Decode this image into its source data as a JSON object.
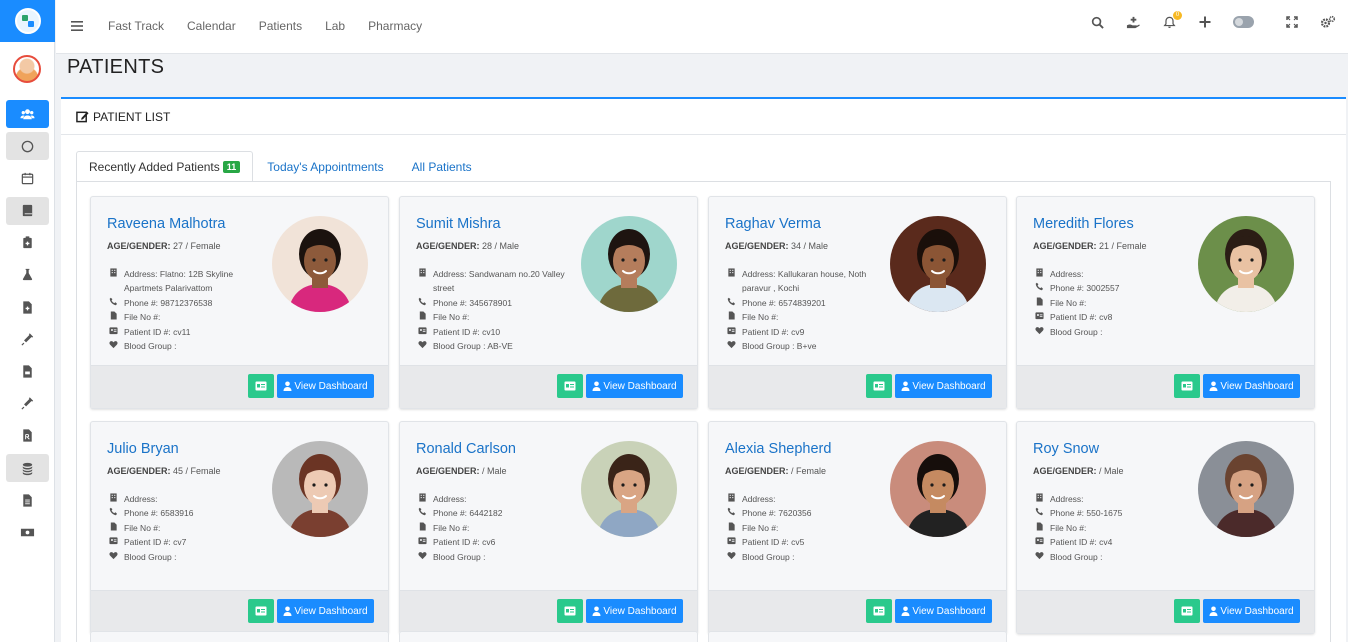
{
  "nav": {
    "items": [
      "Fast Track",
      "Calendar",
      "Patients",
      "Lab",
      "Pharmacy"
    ]
  },
  "notifications": {
    "count": "0"
  },
  "page": {
    "title": "PATIENTS"
  },
  "panel": {
    "title": "PATIENT LIST"
  },
  "tabs": [
    {
      "label": "Recently Added Patients",
      "badge": "11"
    },
    {
      "label": "Today's Appointments"
    },
    {
      "label": "All Patients"
    }
  ],
  "labels": {
    "age_gender": "AGE/GENDER:",
    "view_dashboard": "View Dashboard"
  },
  "patients": [
    {
      "name": "Raveena Malhotra",
      "age_gender": " 27 / Female",
      "address": "Address: Flatno: 12B Skyline Apartmets Palarivattom",
      "phone": "Phone #: 98712376538",
      "file": "File No #:",
      "patient_id": "Patient ID #: cv11",
      "blood": "Blood Group :",
      "photo": {
        "bg": "#f1e3d8",
        "skin": "#8d5a3b",
        "hair": "#1b120e",
        "shirt": "#d8287d"
      }
    },
    {
      "name": "Sumit Mishra",
      "age_gender": " 28 / Male",
      "address": "Address: Sandwanam no.20 Valley street",
      "phone": "Phone #: 345678901",
      "file": "File No #:",
      "patient_id": "Patient ID #: cv10",
      "blood": "Blood Group : AB-VE",
      "photo": {
        "bg": "#9fd6cc",
        "skin": "#b57d5c",
        "hair": "#1e1410",
        "shirt": "#6e6a3c"
      }
    },
    {
      "name": "Raghav Verma",
      "age_gender": " 34 / Male",
      "address": "Address: Kallukaran house, Noth paravur , Kochi",
      "phone": "Phone #: 6574839201",
      "file": "File No #:",
      "patient_id": "Patient ID #: cv9",
      "blood": "Blood Group : B+ve",
      "photo": {
        "bg": "#5a2a1c",
        "skin": "#8b5535",
        "hair": "#1a0f0a",
        "shirt": "#dbe7f2"
      }
    },
    {
      "name": "Meredith Flores",
      "age_gender": " 21 / Female",
      "address": "Address:",
      "phone": "Phone #: 3002557",
      "file": "File No #:",
      "patient_id": "Patient ID #: cv8",
      "blood": "Blood Group :",
      "photo": {
        "bg": "#6c8f4a",
        "skin": "#e9c2a3",
        "hair": "#2b1d15",
        "shirt": "#f2eee8"
      }
    },
    {
      "name": "Julio Bryan",
      "age_gender": " 45 / Female",
      "address": "Address:",
      "phone": "Phone #: 6583916",
      "file": "File No #:",
      "patient_id": "Patient ID #: cv7",
      "blood": "Blood Group :",
      "photo": {
        "bg": "#b9b9b9",
        "skin": "#edcab4",
        "hair": "#6b3424",
        "shirt": "#7a3f30"
      }
    },
    {
      "name": "Ronald Carlson",
      "age_gender": " / Male",
      "address": "Address:",
      "phone": "Phone #: 6442182",
      "file": "File No #:",
      "patient_id": "Patient ID #: cv6",
      "blood": "Blood Group :",
      "photo": {
        "bg": "#c9d2b8",
        "skin": "#d9a584",
        "hair": "#3a2418",
        "shirt": "#8fa7c4"
      }
    },
    {
      "name": "Alexia Shepherd",
      "age_gender": " / Female",
      "address": "Address:",
      "phone": "Phone #: 7620356",
      "file": "File No #:",
      "patient_id": "Patient ID #: cv5",
      "blood": "Blood Group :",
      "photo": {
        "bg": "#c98c7c",
        "skin": "#c58a61",
        "hair": "#160e0b",
        "shirt": "#222222"
      }
    },
    {
      "name": "Roy Snow",
      "age_gender": " / Male",
      "address": "Address:",
      "phone": "Phone #: 550-1675",
      "file": "File No #:",
      "patient_id": "Patient ID #: cv4",
      "blood": "Blood Group :",
      "photo": {
        "bg": "#8a8f97",
        "skin": "#d6a283",
        "hair": "#6a4330",
        "shirt": "#4b2a2a"
      }
    }
  ],
  "colors": {
    "primary": "#1a8cff",
    "success": "#28a745",
    "teal": "#2ac98c",
    "link": "#1a73c8"
  }
}
